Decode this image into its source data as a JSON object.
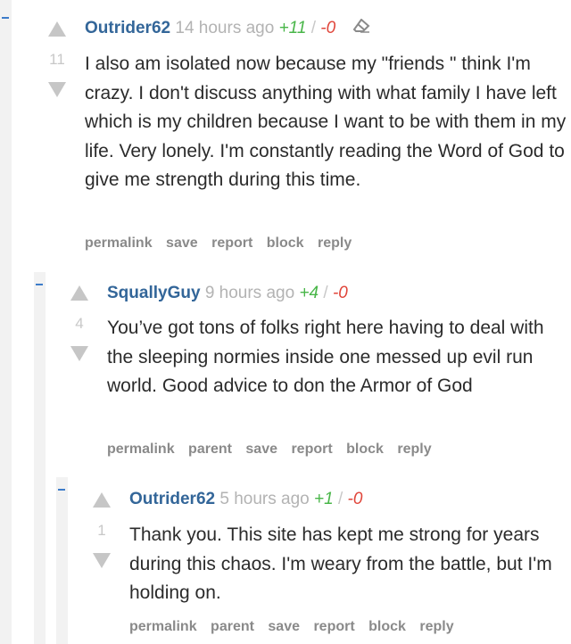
{
  "comments": [
    {
      "author": "Outrider62",
      "time": "14 hours ago",
      "plus": "+11",
      "slash": "/",
      "minus": "-0",
      "score": "11",
      "icon": "eraser-icon",
      "text": "I also am isolated now because my \"friends \" think I'm crazy. I don't discuss anything with what family I have left which is my children because I want to be with them in my life. Very lonely. I'm constantly reading the Word of God to give me strength during this time.",
      "actions": [
        "permalink",
        "save",
        "report",
        "block",
        "reply"
      ]
    },
    {
      "author": "SquallyGuy",
      "time": "9 hours ago",
      "plus": "+4",
      "slash": "/",
      "minus": "-0",
      "score": "4",
      "text": "You’ve got tons of folks right here having to deal with the sleeping normies inside one messed up evil run world. Good advice to don the Armor of God",
      "actions": [
        "permalink",
        "parent",
        "save",
        "report",
        "block",
        "reply"
      ]
    },
    {
      "author": "Outrider62",
      "time": "5 hours ago",
      "plus": "+1",
      "slash": "/",
      "minus": "-0",
      "score": "1",
      "text": "Thank you. This site has kept me strong for years during this chaos. I'm weary from the battle, but I'm holding on.",
      "actions": [
        "permalink",
        "parent",
        "save",
        "report",
        "block",
        "reply"
      ]
    }
  ],
  "colors": {
    "author": "#336699",
    "plus": "#49b649",
    "minus": "#e0453a",
    "collapse": "#3d7cc9"
  }
}
